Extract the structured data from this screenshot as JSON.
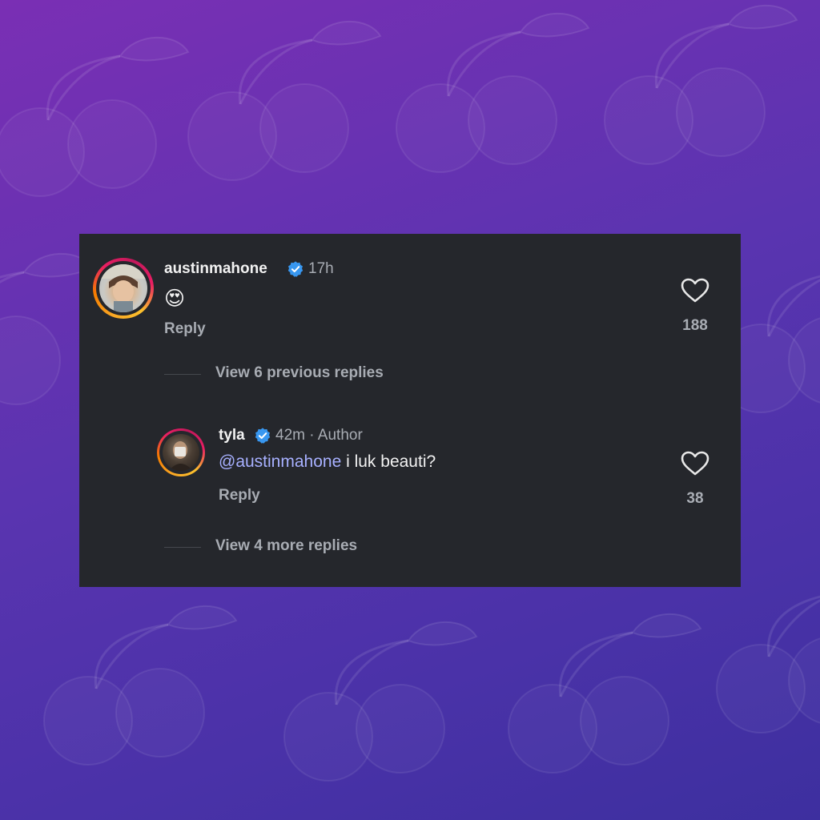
{
  "colors": {
    "background_start": "#7a2fb4",
    "background_end": "#3d2f9f",
    "card": "#25272c",
    "mention": "#a7b0ff",
    "verified": "#3897f0"
  },
  "comments": [
    {
      "username": "austinmahone",
      "verified": true,
      "time": "17h",
      "text": "😍",
      "reply_label": "Reply",
      "likes": "188",
      "view_replies": "View 6 previous replies"
    },
    {
      "username": "tyla",
      "verified": true,
      "time": "42m · Author",
      "mention": "@austinmahone",
      "text": " i luk beauti?",
      "reply_label": "Reply",
      "likes": "38",
      "view_replies": "View 4 more replies"
    }
  ],
  "icons": {
    "verified": "verified-badge-icon",
    "like": "heart-icon",
    "background": "cherry-pattern"
  }
}
